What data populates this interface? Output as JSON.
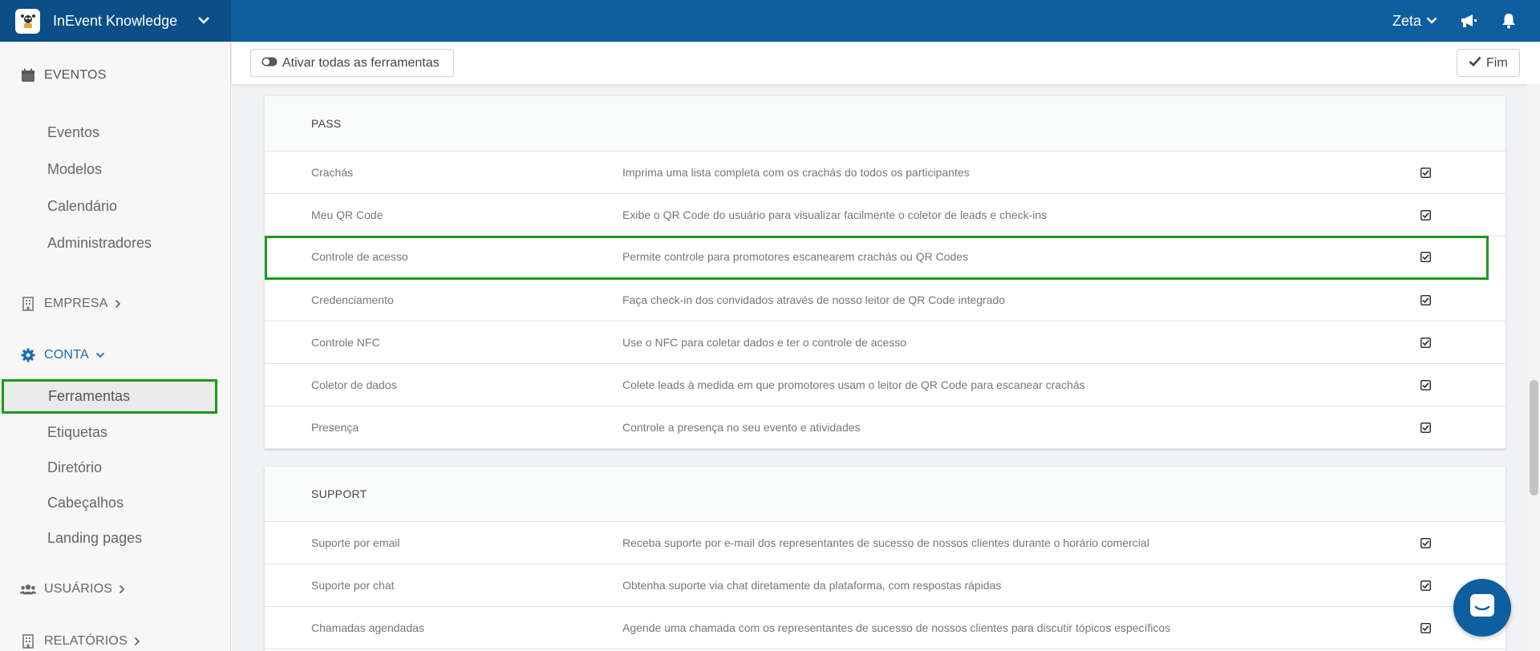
{
  "header": {
    "app_title": "InEvent Knowledge",
    "user_name": "Zeta",
    "icons": [
      "app-logo-icon",
      "chevron-down-icon",
      "megaphone-icon",
      "bell-icon"
    ]
  },
  "sidebar": {
    "eventos": {
      "label": "EVENTOS",
      "items": [
        "Eventos",
        "Modelos",
        "Calendário",
        "Administradores"
      ]
    },
    "empresa": {
      "label": "EMPRESA"
    },
    "conta": {
      "label": "CONTA",
      "items": [
        "Ferramentas",
        "Etiquetas",
        "Diretório",
        "Cabeçalhos",
        "Landing pages"
      ],
      "active": "Ferramentas"
    },
    "usuarios": {
      "label": "USUÁRIOS"
    },
    "relatorios": {
      "label": "RELATÓRIOS"
    }
  },
  "toolbar": {
    "activate_all_label": "Ativar todas as ferramentas",
    "finish_label": "Fim"
  },
  "sections": {
    "pass": {
      "title": "PASS",
      "rows": [
        {
          "name": "Crachás",
          "desc": "Imprima uma lista completa com os crachás do todos os participantes",
          "checked": true
        },
        {
          "name": "Meu QR Code",
          "desc": "Exibe o QR Code do usuário para visualizar facilmente o coletor de leads e check-ins",
          "checked": true
        },
        {
          "name": "Controle de acesso",
          "desc": "Permite controle para promotores escanearem crachás ou QR Codes",
          "checked": true
        },
        {
          "name": "Credenciamento",
          "desc": "Faça check-in dos convidados através de nosso leitor de QR Code integrado",
          "checked": true
        },
        {
          "name": "Controle NFC",
          "desc": "Use o NFC para coletar dados e ter o controle de acesso",
          "checked": true
        },
        {
          "name": "Coletor de dados",
          "desc": "Colete leads à medida em que promotores usam o leitor de QR Code para escanear crachás",
          "checked": true
        },
        {
          "name": "Presença",
          "desc": "Controle a presença no seu evento e atividades",
          "checked": true
        }
      ]
    },
    "support": {
      "title": "SUPPORT",
      "rows": [
        {
          "name": "Suporte por email",
          "desc": "Receba suporte por e-mail dos representantes de sucesso de nossos clientes durante o horário comercial",
          "checked": true
        },
        {
          "name": "Suporte por chat",
          "desc": "Obtenha suporte via chat diretamente da plataforma, com respostas rápidas",
          "checked": true
        },
        {
          "name": "Chamadas agendadas",
          "desc": "Agende uma chamada com os representantes de sucesso de nossos clientes para discutir tópicos específicos",
          "checked": true
        }
      ]
    }
  },
  "colors": {
    "topbar": "#0d5fa0",
    "brand": "#0a4f87",
    "highlight": "#1c9a1c",
    "link_blue": "#1a6bb0"
  }
}
